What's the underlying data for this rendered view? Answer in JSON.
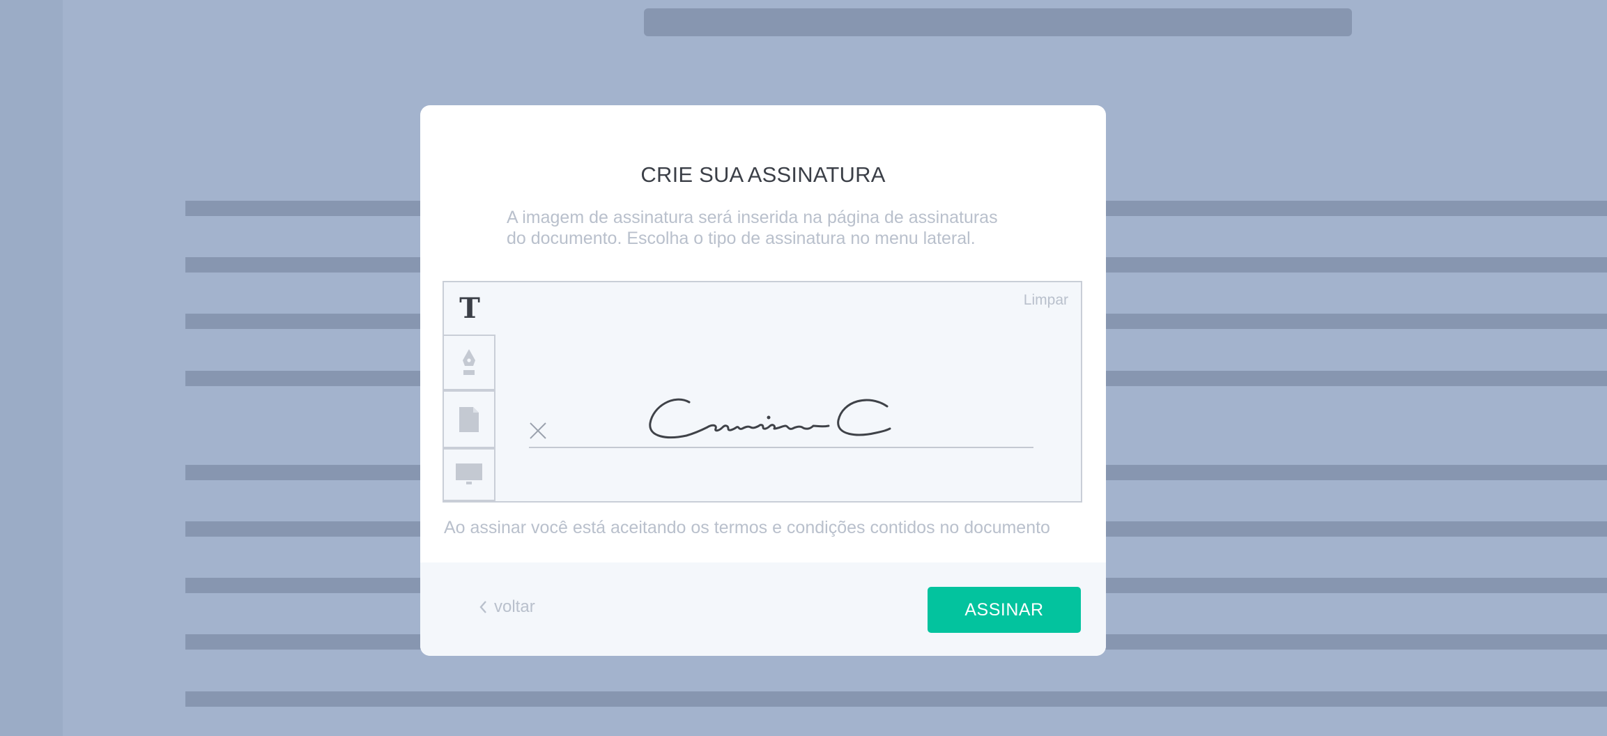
{
  "modal": {
    "title": "CRIE SUA ASSINATURA",
    "description_line1": "A imagem de assinatura será inserida na página de assinaturas",
    "description_line2": "do documento. Escolha o tipo de assinatura no menu lateral.",
    "clear_label": "Limpar",
    "terms": "Ao assinar você está aceitando os termos e condições contidos no documento",
    "back_label": "voltar",
    "sign_label": "ASSINAR"
  },
  "signature_tools": [
    {
      "icon": "text-t-icon",
      "glyph": "T",
      "active": true
    },
    {
      "icon": "pen-nib-icon",
      "active": false
    },
    {
      "icon": "document-icon",
      "active": false
    },
    {
      "icon": "monitor-icon",
      "active": false
    }
  ],
  "colors": {
    "backdrop": "#a3b3cd",
    "accent": "#03c39e",
    "muted_text": "#b9c0cc",
    "dark_text": "#3b3f47"
  }
}
